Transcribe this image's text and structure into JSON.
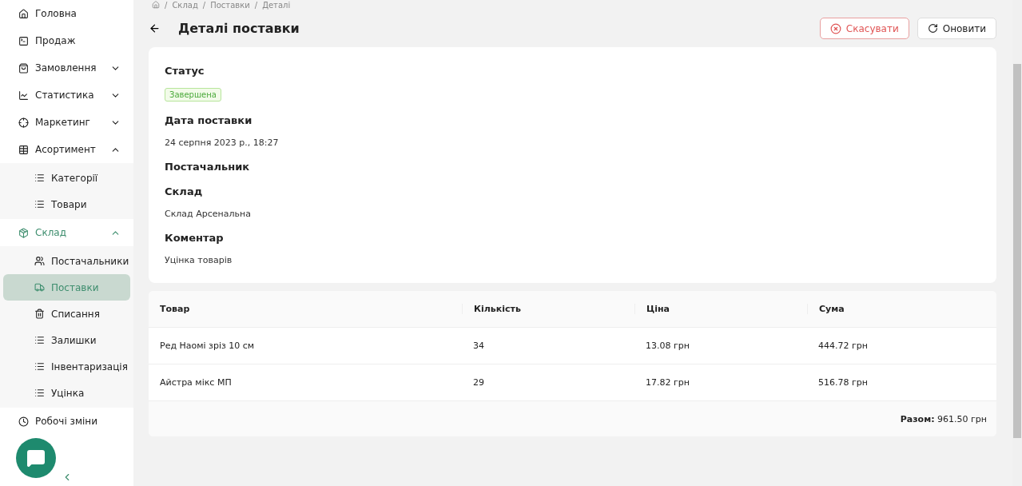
{
  "sidebar": {
    "items": [
      {
        "label": "Головна",
        "selected": false
      },
      {
        "label": "Продаж",
        "selected": false
      },
      {
        "label": "Замовлення",
        "expanded": false,
        "selected": false
      },
      {
        "label": "Статистика",
        "expanded": false,
        "selected": false
      },
      {
        "label": "Маркетинг",
        "expanded": false,
        "selected": false
      },
      {
        "label": "Асортимент",
        "expanded": true,
        "selected": false,
        "children": [
          {
            "label": "Категорії",
            "selected": false
          },
          {
            "label": "Товари",
            "selected": false
          }
        ]
      },
      {
        "label": "Склад",
        "expanded": true,
        "selected": true,
        "children": [
          {
            "label": "Постачальники",
            "selected": false
          },
          {
            "label": "Поставки",
            "selected": true
          },
          {
            "label": "Списання",
            "selected": false
          },
          {
            "label": "Залишки",
            "selected": false
          },
          {
            "label": "Інвентаризація",
            "selected": false
          },
          {
            "label": "Уцінка",
            "selected": false
          }
        ]
      },
      {
        "label": "Робочі зміни",
        "selected": false
      }
    ]
  },
  "breadcrumb": {
    "separator": "/",
    "items": [
      "Склад",
      "Поставки",
      "Деталі"
    ]
  },
  "title": "Деталі поставки",
  "buttons": [
    {
      "label": "Скасувати",
      "kind": "danger"
    },
    {
      "label": "Оновити",
      "kind": "default"
    }
  ],
  "details": [
    {
      "label": "Статус",
      "kind": "tag",
      "value": "Завершена"
    },
    {
      "label": "Дата поставки",
      "kind": "text",
      "value": "24 серпня 2023 р., 18:27"
    },
    {
      "label": "Постачальник"
    },
    {
      "label": "Склад",
      "kind": "text",
      "value": "Склад Арсенальна"
    },
    {
      "label": "Коментар",
      "kind": "text",
      "value": "Уцінка товарів"
    }
  ],
  "table": {
    "columns": [
      "Товар",
      "Кількість",
      "Ціна",
      "Сума"
    ],
    "rows": [
      [
        "Ред Наомі зріз 10 см",
        "34",
        "13.08 грн",
        "444.72 грн"
      ],
      [
        "Айстра мікс МП",
        "29",
        "17.82 грн",
        "516.78 грн"
      ]
    ],
    "total": {
      "label": "Разом:",
      "value": "961.50 грн"
    }
  }
}
